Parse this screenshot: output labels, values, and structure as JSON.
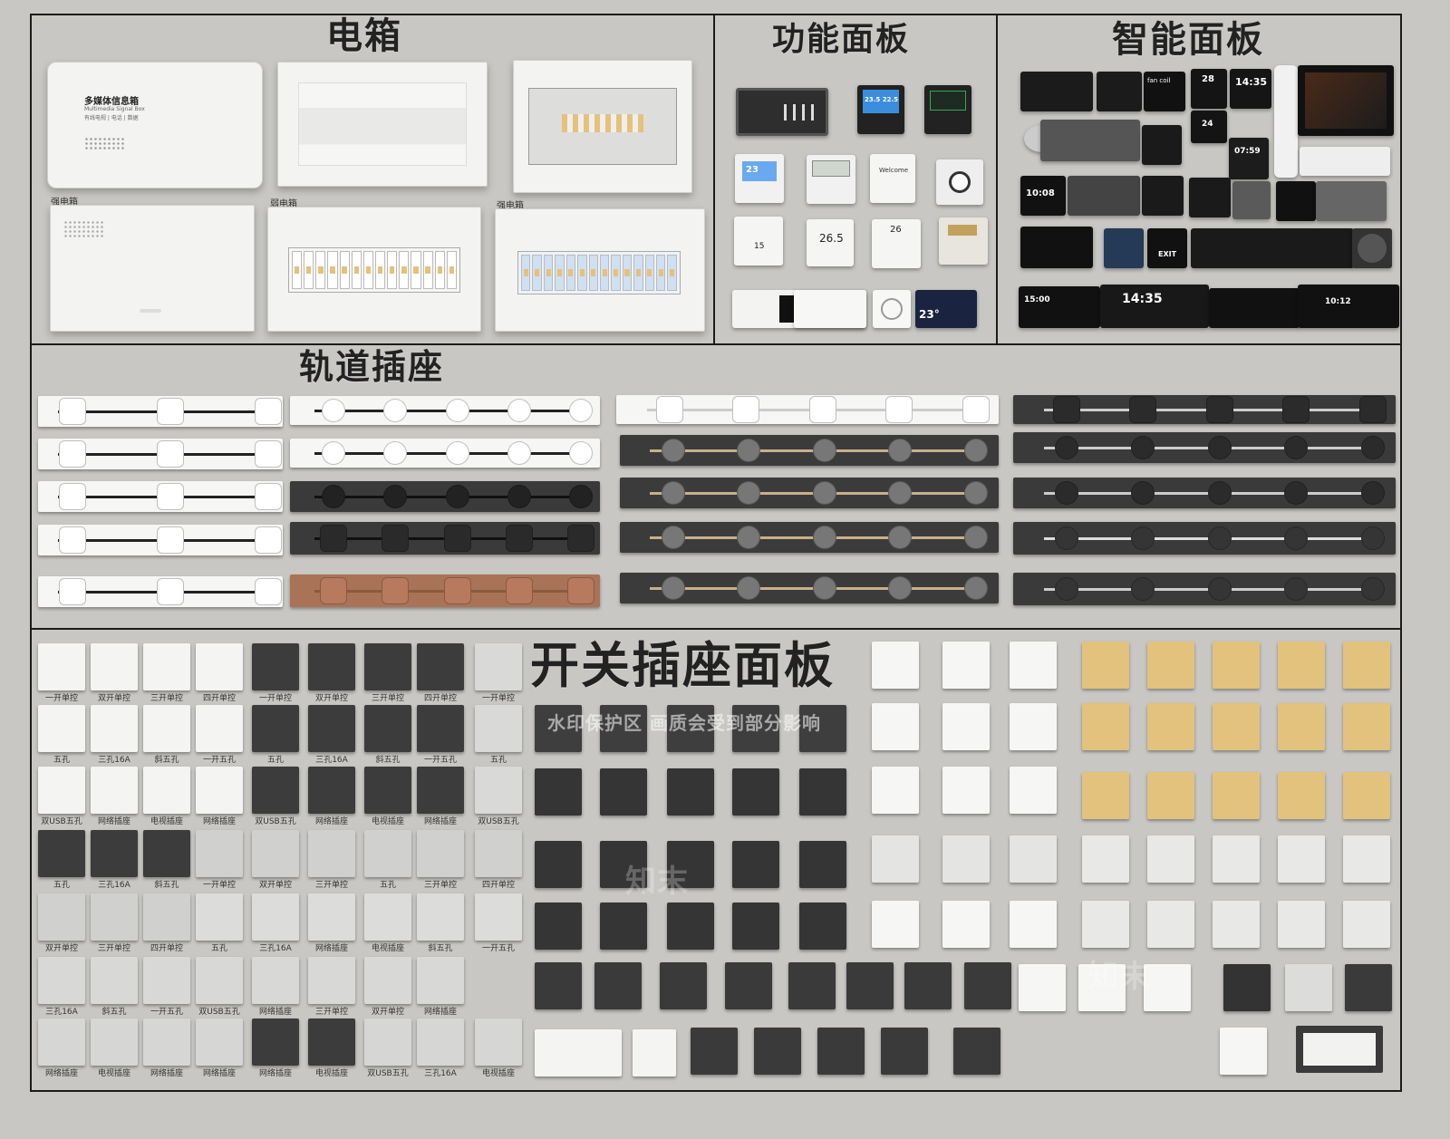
{
  "sections": {
    "electrical_box": "电箱",
    "function_panel": "功能面板",
    "smart_panel": "智能面板",
    "track_socket": "轨道插座",
    "switch_socket_panel": "开关插座面板"
  },
  "electrical_box": {
    "media_box_title": "多媒体信息箱",
    "media_box_subtitle": "Multimedia Signal Box",
    "media_box_tags": "有线电视 | 电话 | 数据",
    "label_strong": "强电箱",
    "label_weak": "弱电箱",
    "label_strong_2": "强电箱"
  },
  "function_panel": {
    "thermo_a": "23.5 22.5",
    "thermo_b": "23",
    "display_a": "26",
    "display_b": "26.5",
    "display_c": "15",
    "card_label": "Welcome",
    "temp_small": "23°"
  },
  "smart_panel": {
    "fan_coil": "fan coil",
    "num_28": "28",
    "time_1": "14:35",
    "num_24": "24",
    "time_2": "07:59",
    "time_3": "10:08",
    "exit": "EXIT",
    "time_4": "15:00",
    "time_5": "14:35",
    "time_6": "10:12"
  },
  "switch_labels": {
    "row1": [
      "一开单控",
      "双开单控",
      "三开单控",
      "四开单控",
      "一开单控",
      "双开单控",
      "三开单控",
      "四开单控",
      "一开单控"
    ],
    "row2": [
      "五孔",
      "三孔16A",
      "斜五孔",
      "一开五孔",
      "五孔",
      "三孔16A",
      "斜五孔",
      "一开五孔",
      "五孔"
    ],
    "row3": [
      "双USB五孔",
      "网络插座",
      "电视插座",
      "网络插座",
      "双USB五孔",
      "网络插座",
      "电视插座",
      "网络插座",
      "双USB五孔"
    ],
    "row4": [
      "五孔",
      "三孔16A",
      "斜五孔",
      "一开单控",
      "双开单控",
      "三开单控",
      "五孔",
      "三开单控",
      "四开单控"
    ],
    "row5": [
      "双开单控",
      "三开单控",
      "四开单控",
      "五孔",
      "三孔16A",
      "网络插座",
      "电视插座",
      "斜五孔",
      "一开五孔"
    ],
    "row6": [
      "三孔16A",
      "斜五孔",
      "一开五孔",
      "双USB五孔",
      "网络插座",
      "三开单控",
      "双开单控",
      "网络插座"
    ],
    "row7": [
      "网络插座",
      "电视插座",
      "网络插座",
      "网络插座",
      "网络插座",
      "电视插座",
      "双USB五孔",
      "三孔16A",
      "电视插座"
    ]
  },
  "watermark": {
    "notice": "水印保护区   画质会受到部分影响",
    "brand": "知末"
  },
  "colors": {
    "background": "#c8c7c3",
    "frame": "#1c1c1c",
    "gold": "#e2c27c",
    "copper": "#b77a5e",
    "dark": "#3a3a3a"
  }
}
